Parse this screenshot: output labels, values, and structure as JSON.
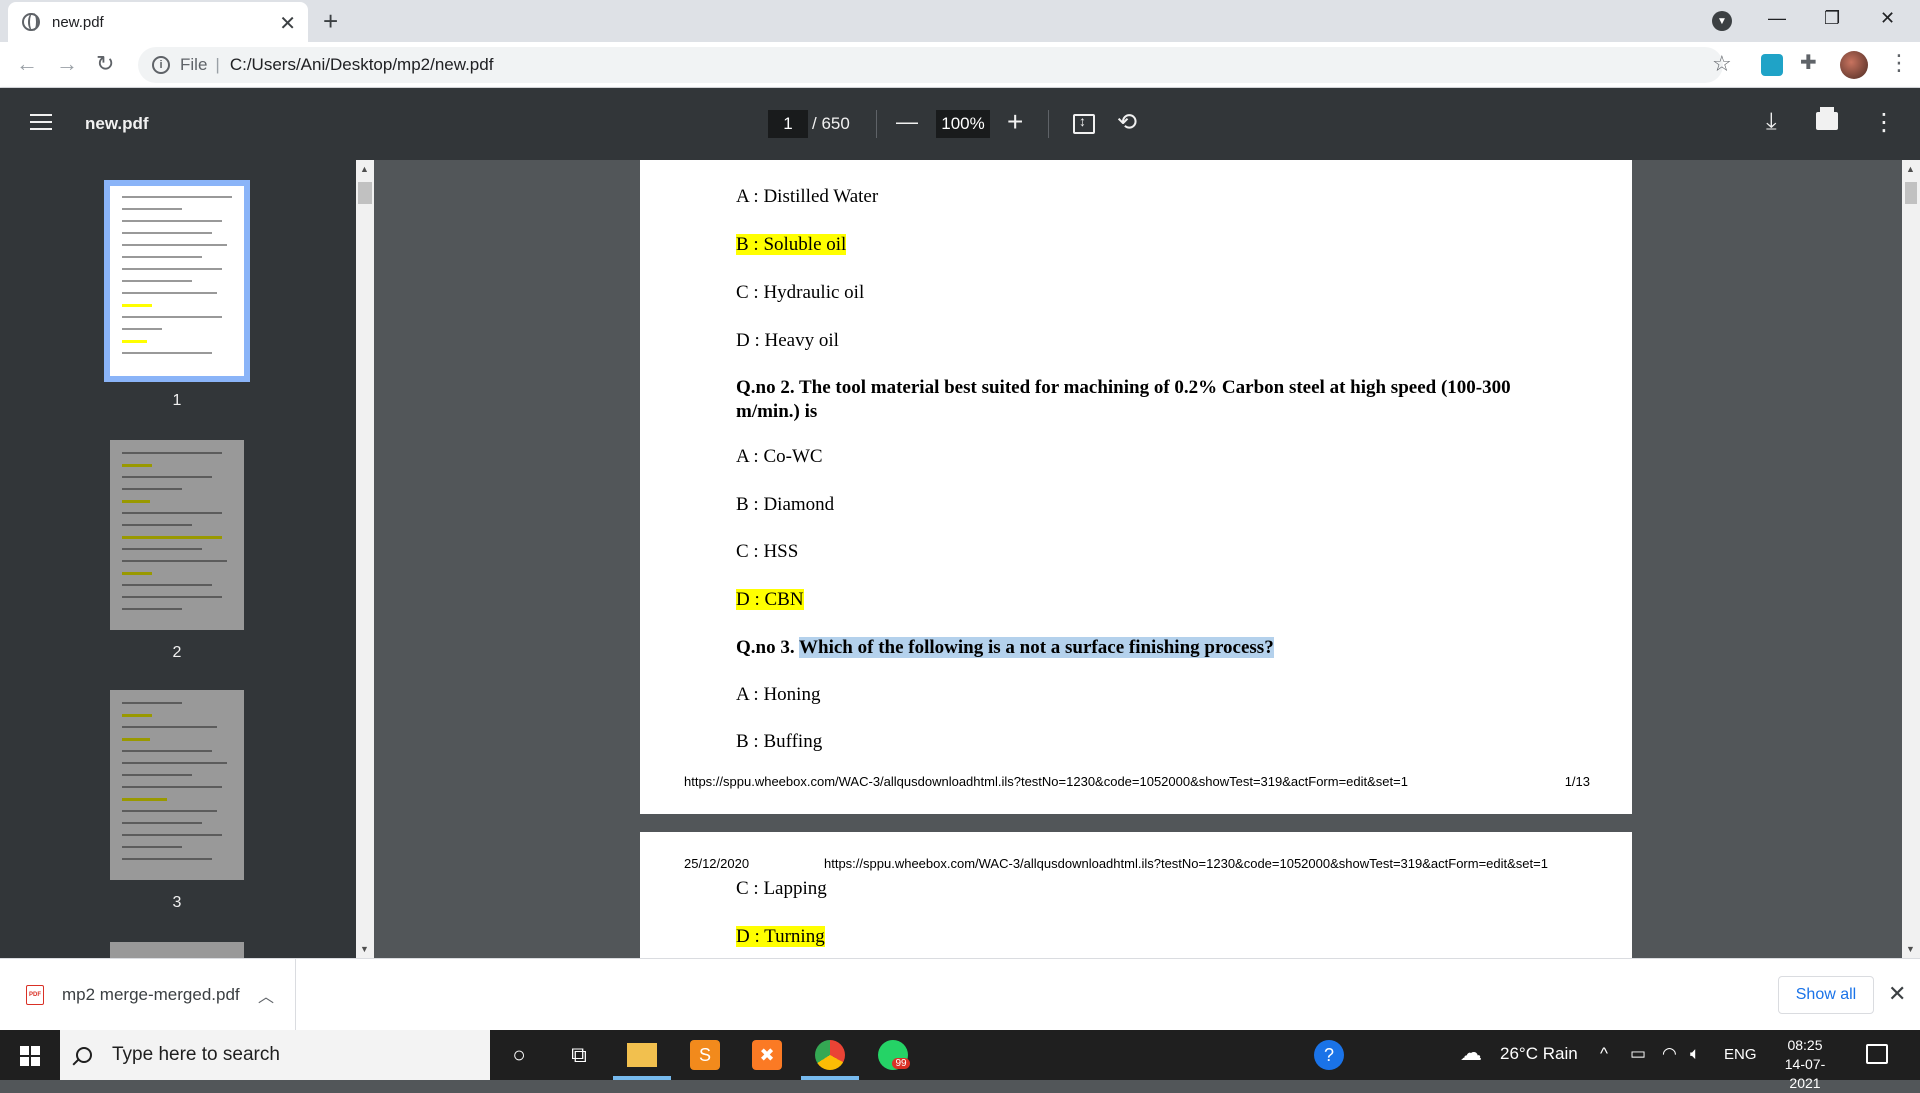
{
  "browser": {
    "tab_title": "new.pdf",
    "tab_close": "✕",
    "new_tab": "+",
    "url_scheme": "File",
    "url_path": "C:/Users/Ani/Desktop/mp2/new.pdf",
    "min": "—",
    "max": "❐",
    "close": "✕"
  },
  "pdf_toolbar": {
    "title": "new.pdf",
    "current_page": "1",
    "total_pages": "/ 650",
    "zoom": "100%",
    "zoom_out": "—",
    "zoom_in": "+"
  },
  "thumbnails": [
    {
      "label": "1"
    },
    {
      "label": "2"
    },
    {
      "label": "3"
    }
  ],
  "page1": {
    "options_q1": [
      {
        "text": "A : Distilled Water",
        "highlighted": false
      },
      {
        "text": "B : Soluble oil",
        "highlighted": true
      },
      {
        "text": "C : Hydraulic oil",
        "highlighted": false
      },
      {
        "text": "D : Heavy oil",
        "highlighted": false
      }
    ],
    "q2": "Q.no 2. The tool material best suited for machining of 0.2% Carbon steel at high speed (100-300 m/min.) is",
    "options_q2": [
      {
        "text": "A : Co-WC",
        "highlighted": false
      },
      {
        "text": "B : Diamond",
        "highlighted": false
      },
      {
        "text": "C : HSS",
        "highlighted": false
      },
      {
        "text": "D : CBN",
        "highlighted": true
      }
    ],
    "q3_prefix": "Q.no 3. ",
    "q3_text": "Which of the following is a not a surface finishing process?",
    "options_q3": [
      {
        "text": "A : Honing",
        "highlighted": false
      },
      {
        "text": "B : Buffing",
        "highlighted": false
      }
    ],
    "footer_url": "https://sppu.wheebox.com/WAC-3/allqusdownloadhtml.ils?testNo=1230&code=1052000&showTest=319&actForm=edit&set=1",
    "footer_page": "1/13"
  },
  "page2": {
    "header_date": "25/12/2020",
    "header_url": "https://sppu.wheebox.com/WAC-3/allqusdownloadhtml.ils?testNo=1230&code=1052000&showTest=319&actForm=edit&set=1",
    "options": [
      {
        "text": "C : Lapping",
        "highlighted": false
      },
      {
        "text": "D : Turning",
        "highlighted": true
      }
    ]
  },
  "downloads": {
    "file": "mp2 merge-merged.pdf",
    "badge": "PDF",
    "show_all": "Show all"
  },
  "taskbar": {
    "search_placeholder": "Type here to search",
    "weather": "26°C Rain",
    "lang": "ENG",
    "time": "08:25",
    "date": "14-07-2021",
    "whatsapp_badge": "99"
  },
  "colors": {
    "highlight": "#ffff00",
    "selection": "#b4d1ec",
    "toolbar": "#323639",
    "viewer_bg": "#525659"
  }
}
